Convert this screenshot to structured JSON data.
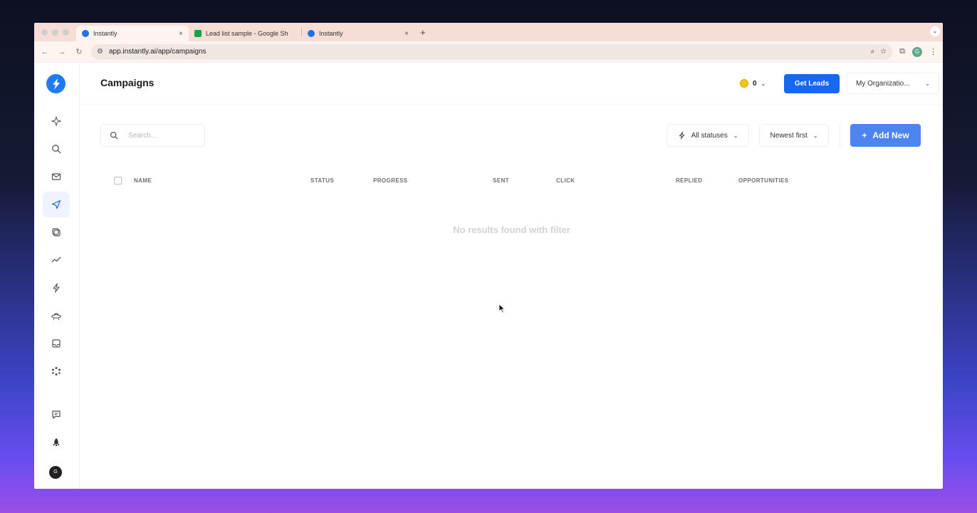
{
  "browser": {
    "tabs": [
      {
        "label": "Instantly",
        "close": "×"
      },
      {
        "label": "Lead list sample - Google Sh",
        "close": "×"
      },
      {
        "label": "Instantly",
        "close": "×"
      }
    ],
    "new_tab": "+",
    "url": "app.instantly.ai/app/campaigns",
    "profile_initial": "G"
  },
  "header": {
    "title": "Campaigns",
    "credits": "0",
    "get_leads_label": "Get Leads",
    "org_label": "My Organizatio..."
  },
  "toolbar": {
    "search_placeholder": "Search...",
    "status_filter": "All statuses",
    "sort": "Newest first",
    "add_new_label": "Add New",
    "add_new_icon": "+"
  },
  "table": {
    "columns": [
      "NAME",
      "STATUS",
      "PROGRESS",
      "SENT",
      "CLICK",
      "REPLIED",
      "OPPORTUNITIES"
    ],
    "empty_message": "No results found with filter"
  },
  "sidebar": {
    "items": [
      "sparkle-icon",
      "search-icon",
      "mail-icon",
      "send-icon",
      "copy-icon",
      "analytics-icon",
      "bolt-icon",
      "ufo-icon",
      "inbox-icon",
      "network-icon",
      "feedback-icon",
      "rocket-icon"
    ],
    "active_item": "send-icon",
    "avatar_initial": "G"
  },
  "colors": {
    "accent": "#1667f2",
    "add_new": "#4d84ef",
    "tab_strip": "#f6ddd6"
  }
}
